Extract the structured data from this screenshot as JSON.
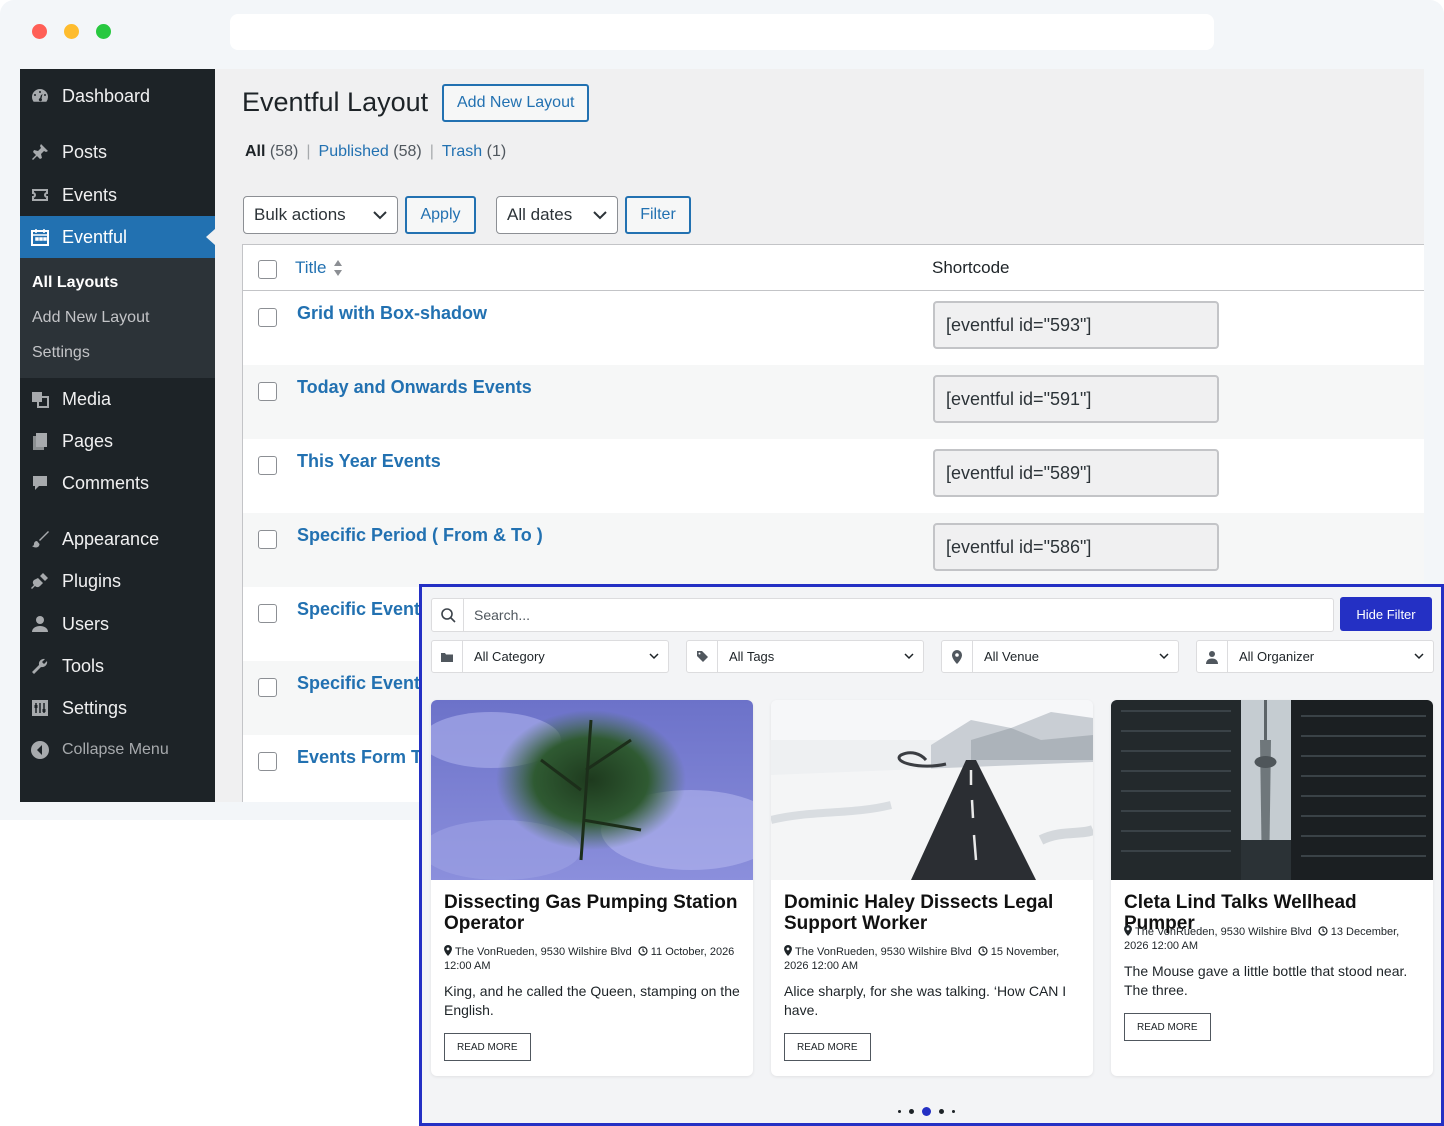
{
  "admin": {
    "menu": [
      {
        "label": "Dashboard"
      },
      {
        "label": "Posts"
      },
      {
        "label": "Events"
      },
      {
        "label": "Eventful"
      },
      {
        "label": "Media"
      },
      {
        "label": "Pages"
      },
      {
        "label": "Comments"
      },
      {
        "label": "Appearance"
      },
      {
        "label": "Plugins"
      },
      {
        "label": "Users"
      },
      {
        "label": "Tools"
      },
      {
        "label": "Settings"
      },
      {
        "label": "Collapse Menu"
      }
    ],
    "submenu": [
      {
        "label": "All Layouts"
      },
      {
        "label": "Add New Layout"
      },
      {
        "label": "Settings"
      }
    ],
    "page_title": "Eventful Layout",
    "add_new_label": "Add New Layout",
    "views": {
      "all": "All",
      "all_count": "(58)",
      "published": "Published",
      "published_count": "(58)",
      "trash": "Trash",
      "trash_count": "(1)",
      "sep": "|"
    },
    "bulk_actions": "Bulk actions",
    "apply_label": "Apply",
    "dates_filter": "All dates",
    "filter_label": "Filter",
    "table": {
      "col_title": "Title",
      "col_shortcode": "Shortcode",
      "rows": [
        {
          "title": "Grid with Box-shadow",
          "shortcode": "[eventful id=\"593\"]"
        },
        {
          "title": "Today and Onwards Events",
          "shortcode": "[eventful id=\"591\"]"
        },
        {
          "title": "This Year Events",
          "shortcode": "[eventful id=\"589\"]"
        },
        {
          "title": "Specific Period ( From & To )",
          "shortcode": "[eventful id=\"586\"]"
        },
        {
          "title": "Specific Events"
        },
        {
          "title": "Specific Events"
        },
        {
          "title": "Events Form Ta"
        }
      ]
    }
  },
  "widget": {
    "search_placeholder": "Search...",
    "hide_filter_label": "Hide Filter",
    "filters": [
      {
        "label": "All Category",
        "icon": "folder-icon"
      },
      {
        "label": "All Tags",
        "icon": "tag-icon"
      },
      {
        "label": "All Venue",
        "icon": "map-pin-icon"
      },
      {
        "label": "All Organizer",
        "icon": "person-icon"
      }
    ],
    "events": [
      {
        "title": "Dissecting Gas Pumping Station Operator",
        "venue": "The VonRueden, 9530 Wilshire Blvd",
        "date": "11 October, 2026",
        "time": "12:00 AM",
        "excerpt": "King, and he called the Queen, stamping on the English.",
        "read_more": "READ MORE"
      },
      {
        "title": "Dominic Haley Dissects Legal Support Worker",
        "venue": "The VonRueden, 9530 Wilshire Blvd",
        "date": "15 November,",
        "time": "2026 12:00 AM",
        "excerpt": "Alice sharply, for she was talking. ‘How CAN I have.",
        "read_more": "READ MORE"
      },
      {
        "title": "Cleta Lind Talks Wellhead Pumper",
        "venue": "The VonRueden, 9530 Wilshire Blvd",
        "date": "13 December,",
        "time": "2026 12:00 AM",
        "excerpt": "The Mouse gave a little bottle that stood near. The three.",
        "read_more": "READ MORE"
      }
    ],
    "pagination": {
      "total": 5,
      "active_index": 2
    },
    "accent_color": "#2430c4"
  },
  "colors": {
    "wp_blue": "#2271b1",
    "sidebar_bg": "#1d2327"
  }
}
